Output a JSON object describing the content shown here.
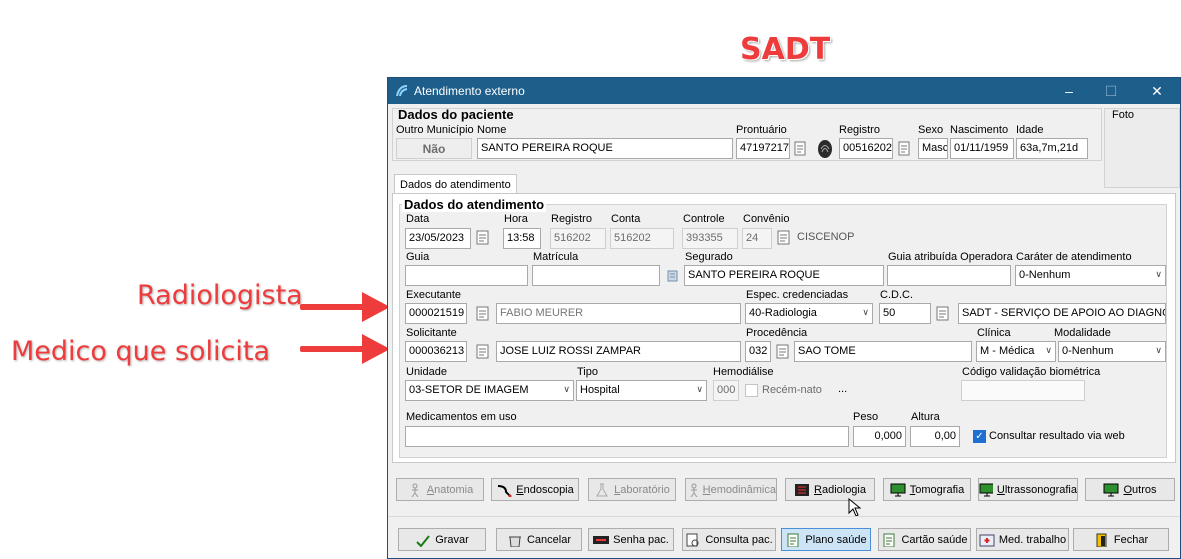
{
  "annotations": {
    "title": "SADT",
    "radiologista": "Radiologista",
    "medico": "Medico que solicita"
  },
  "window": {
    "title": "Atendimento externo",
    "minimize": "–",
    "maximize": "☐",
    "close": "✕"
  },
  "paciente": {
    "header": "Dados do paciente",
    "foto_label": "Foto",
    "outro_municipio_label": "Outro Município",
    "outro_municipio_value": "Não",
    "nome_label": "Nome",
    "nome_value": "SANTO PEREIRA ROQUE",
    "prontuario_label": "Prontuário",
    "prontuario_value": "47197217",
    "registro_label": "Registro",
    "registro_value": "00516202",
    "sexo_label": "Sexo",
    "sexo_value": "Masc",
    "nascimento_label": "Nascimento",
    "nascimento_value": "01/11/1959",
    "idade_label": "Idade",
    "idade_value": "63a,7m,21d"
  },
  "tab_label": "Dados do atendimento",
  "atendimento": {
    "header": "Dados do atendimento",
    "data_label": "Data",
    "data_value": "23/05/2023",
    "hora_label": "Hora",
    "hora_value": "13:58",
    "registro_label": "Registro",
    "registro_value": "516202",
    "conta_label": "Conta",
    "conta_value": "516202",
    "controle_label": "Controle",
    "controle_value": "393355",
    "convenio_label": "Convênio",
    "convenio_code": "24",
    "convenio_name": "CISCENOP",
    "guia_label": "Guia",
    "guia_value": "",
    "matricula_label": "Matrícula",
    "matricula_value": "",
    "segurado_label": "Segurado",
    "segurado_value": "SANTO PEREIRA ROQUE",
    "guia_operadora_label": "Guia atribuída Operadora",
    "guia_operadora_value": "",
    "carater_label": "Caráter de atendimento",
    "carater_value": "0-Nenhum",
    "executante_label": "Executante",
    "executante_code": "000021519",
    "executante_name": "FABIO MEURER",
    "espec_label": "Espec. credenciadas",
    "espec_value": "40-Radiologia",
    "cdc_label": "C.D.C.",
    "cdc_code": "50",
    "cdc_name": "SADT - SERVIÇO DE APOIO AO DIAGNO",
    "solicitante_label": "Solicitante",
    "solicitante_code": "000036213",
    "solicitante_name": "JOSE LUIZ ROSSI ZAMPAR",
    "procedencia_label": "Procedência",
    "procedencia_code": "032",
    "procedencia_name": "SAO TOME",
    "clinica_label": "Clínica",
    "clinica_value": "M - Médica",
    "modalidade_label": "Modalidade",
    "modalidade_value": "0-Nenhum",
    "unidade_label": "Unidade",
    "unidade_value": "03-SETOR DE IMAGEM",
    "tipo_label": "Tipo",
    "tipo_value": "Hospital",
    "hemodialise_label": "Hemodiálise",
    "hemodialise_value": "000",
    "recem_nato_label": "Recém-nato",
    "ellipsis": "...",
    "codigo_bio_label": "Código validação biométrica",
    "medicamentos_label": "Medicamentos em uso",
    "peso_label": "Peso",
    "peso_value": "0,000",
    "altura_label": "Altura",
    "altura_value": "0,00",
    "consultar_label": "Consultar resultado via web"
  },
  "exam_buttons": [
    {
      "label": "Anatomia",
      "u": "A"
    },
    {
      "label": "Endoscopia",
      "u": "E"
    },
    {
      "label": "Laboratório",
      "u": "L"
    },
    {
      "label": "Hemodinâmica",
      "u": "H"
    },
    {
      "label": "Radiologia",
      "u": "R"
    },
    {
      "label": "Tomografia",
      "u": "T"
    },
    {
      "label": "Ultrassonografia",
      "u": "U"
    },
    {
      "label": "Outros",
      "u": "O"
    }
  ],
  "action_buttons": [
    {
      "label": "Gravar"
    },
    {
      "label": "Cancelar"
    },
    {
      "label": "Senha pac."
    },
    {
      "label": "Consulta pac."
    },
    {
      "label": "Plano saúde"
    },
    {
      "label": "Cartão saúde"
    },
    {
      "label": "Med. trabalho"
    },
    {
      "label": "Fechar"
    }
  ],
  "colors": {
    "titlebar": "#1d5e8b",
    "annotation_red": "#ee3b3b",
    "checkbox_on": "#1e6fd1"
  }
}
